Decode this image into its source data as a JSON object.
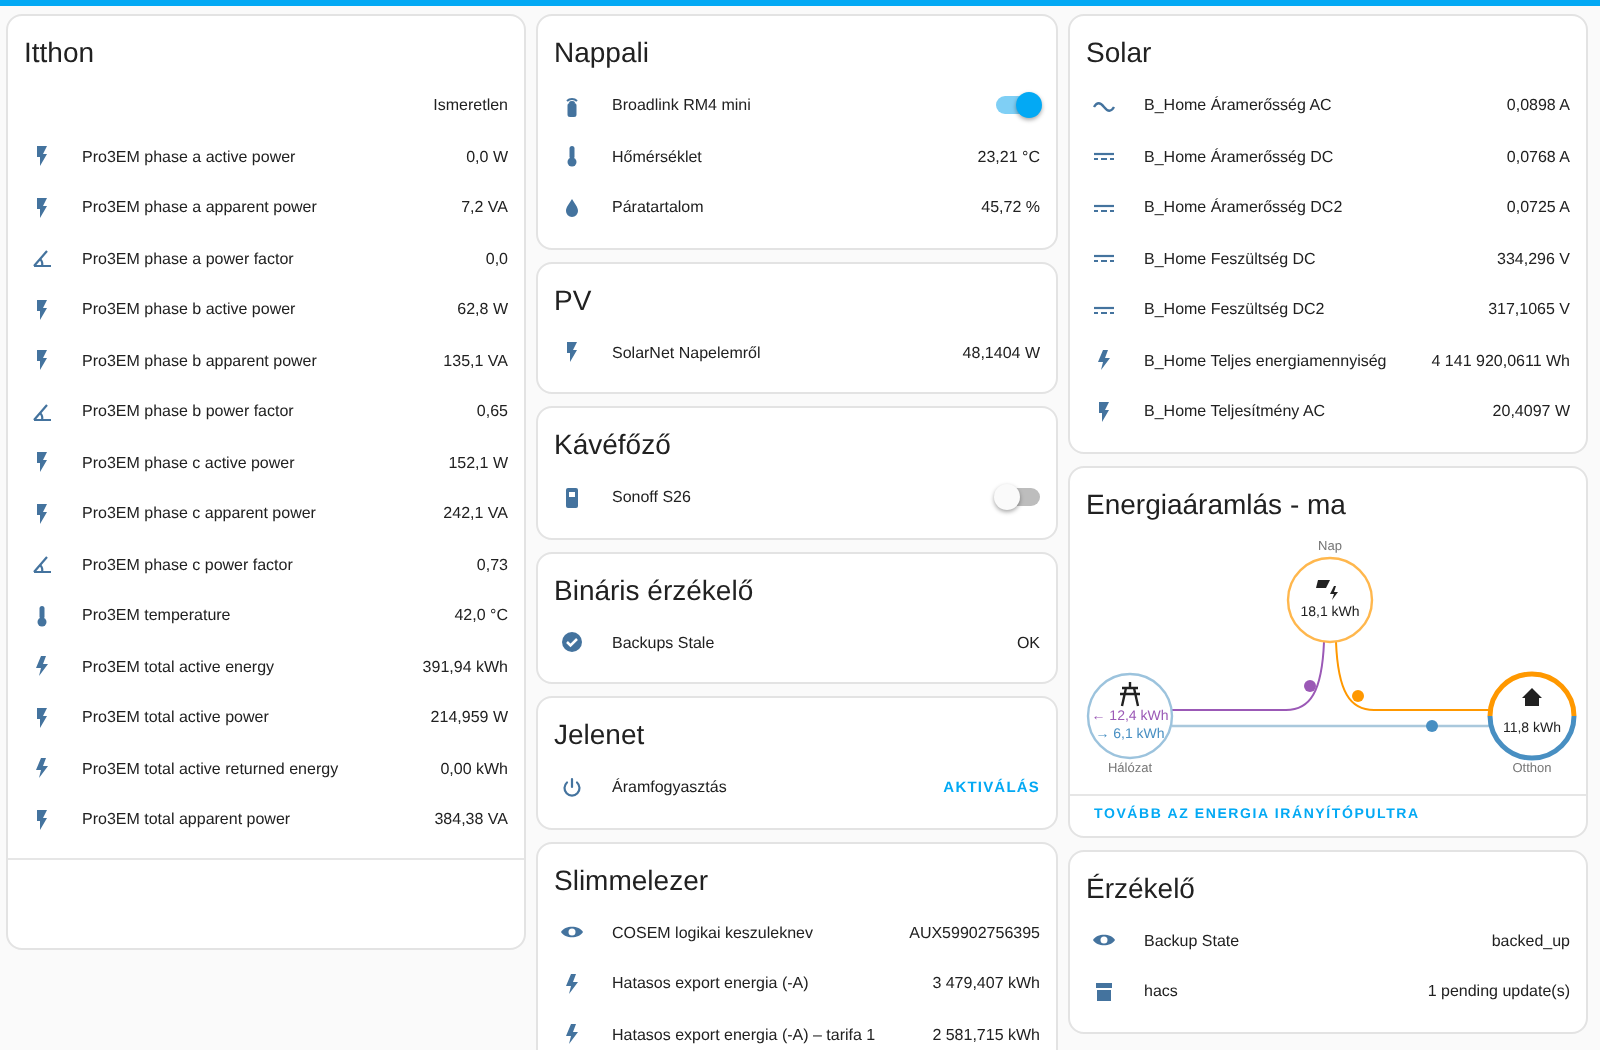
{
  "columns": [
    {
      "cards": [
        {
          "kind": "entities",
          "title": "Itthon",
          "footer": true,
          "rows": [
            {
              "kind": "plain",
              "value": "Ismeretlen"
            },
            {
              "kind": "bolt",
              "name": "Pro3EM phase a active power",
              "value": "0,0 W"
            },
            {
              "kind": "bolt",
              "name": "Pro3EM phase a apparent power",
              "value": "7,2 VA"
            },
            {
              "kind": "angle",
              "name": "Pro3EM phase a power factor",
              "value": "0,0"
            },
            {
              "kind": "bolt",
              "name": "Pro3EM phase b active power",
              "value": "62,8 W"
            },
            {
              "kind": "bolt",
              "name": "Pro3EM phase b apparent power",
              "value": "135,1 VA"
            },
            {
              "kind": "angle",
              "name": "Pro3EM phase b power factor",
              "value": "0,65"
            },
            {
              "kind": "bolt",
              "name": "Pro3EM phase c active power",
              "value": "152,1 W"
            },
            {
              "kind": "bolt",
              "name": "Pro3EM phase c apparent power",
              "value": "242,1 VA"
            },
            {
              "kind": "angle",
              "name": "Pro3EM phase c power factor",
              "value": "0,73"
            },
            {
              "kind": "thermometer",
              "name": "Pro3EM temperature",
              "value": "42,0 °C"
            },
            {
              "kind": "flash",
              "name": "Pro3EM total active energy",
              "value": "391,94 kWh"
            },
            {
              "kind": "bolt",
              "name": "Pro3EM total active power",
              "value": "214,959 W"
            },
            {
              "kind": "flash",
              "name": "Pro3EM total active returned energy",
              "value": "0,00 kWh"
            },
            {
              "kind": "bolt",
              "name": "Pro3EM total apparent power",
              "value": "384,38 VA"
            }
          ]
        }
      ]
    },
    {
      "cards": [
        {
          "kind": "entities",
          "title": "Nappali",
          "rows": [
            {
              "kind": "remote",
              "name": "Broadlink RM4 mini",
              "on": true
            },
            {
              "kind": "thermometer",
              "name": "Hőmérséklet",
              "value": "23,21 °C"
            },
            {
              "kind": "drop",
              "name": "Páratartalom",
              "value": "45,72 %"
            }
          ]
        },
        {
          "kind": "entities",
          "title": "PV",
          "rows": [
            {
              "kind": "bolt",
              "name": "SolarNet Napelemről",
              "value": "48,1404 W"
            }
          ]
        },
        {
          "kind": "entities",
          "title": "Kávéfőző",
          "rows": [
            {
              "kind": "outlet",
              "name": "Sonoff S26",
              "on": false
            }
          ]
        },
        {
          "kind": "entities",
          "title": "Bináris érzékelő",
          "rows": [
            {
              "kind": "check",
              "name": "Backups Stale",
              "value": "OK"
            }
          ]
        },
        {
          "kind": "entities",
          "title": "Jelenet",
          "rows": [
            {
              "kind": "power",
              "name": "Áramfogyasztás",
              "action": "AKTIVÁLÁS"
            }
          ]
        },
        {
          "kind": "entities",
          "title": "Slimmelezer",
          "rows": [
            {
              "kind": "eye",
              "name": "COSEM logikai keszuleknev",
              "value": "AUX59902756395"
            },
            {
              "kind": "flash",
              "name": "Hatasos export energia (-A)",
              "value": "3 479,407 kWh"
            },
            {
              "kind": "flash",
              "name": "Hatasos export energia (-A) – tarifa 1",
              "value": "2 581,715 kWh"
            }
          ]
        }
      ]
    },
    {
      "cards": [
        {
          "kind": "entities",
          "title": "Solar",
          "rows": [
            {
              "kind": "ac",
              "name": "B_Home Áramerősség AC",
              "value": "0,0898 A"
            },
            {
              "kind": "dc",
              "name": "B_Home Áramerősség DC",
              "value": "0,0768 A"
            },
            {
              "kind": "dc",
              "name": "B_Home Áramerősség DC2",
              "value": "0,0725 A"
            },
            {
              "kind": "dc",
              "name": "B_Home Feszültség DC",
              "value": "334,296 V"
            },
            {
              "kind": "dc",
              "name": "B_Home Feszültség DC2",
              "value": "317,1065 V"
            },
            {
              "kind": "flash",
              "name": "B_Home Teljes energiamennyiség",
              "value": "4 141 920,0611 Wh"
            },
            {
              "kind": "bolt",
              "name": "B_Home Teljesítmény AC",
              "value": "20,4097 W"
            }
          ]
        },
        {
          "kind": "energy",
          "title": "Energiaáramlás - ma",
          "solar": {
            "label": "Nap",
            "value": "18,1 kWh"
          },
          "grid": {
            "label": "Hálózat",
            "import": "← 12,4 kWh",
            "export": "→ 6,1 kWh"
          },
          "home": {
            "label": "Otthon",
            "value": "11,8 kWh"
          },
          "link": "TOVÁBB AZ ENERGIA IRÁNYÍTÓPULTRA"
        },
        {
          "kind": "entities",
          "title": "Érzékelő",
          "rows": [
            {
              "kind": "eye",
              "name": "Backup State",
              "value": "backed_up"
            },
            {
              "kind": "store",
              "name": "hacs",
              "value": "1 pending update(s)"
            }
          ]
        }
      ]
    }
  ]
}
